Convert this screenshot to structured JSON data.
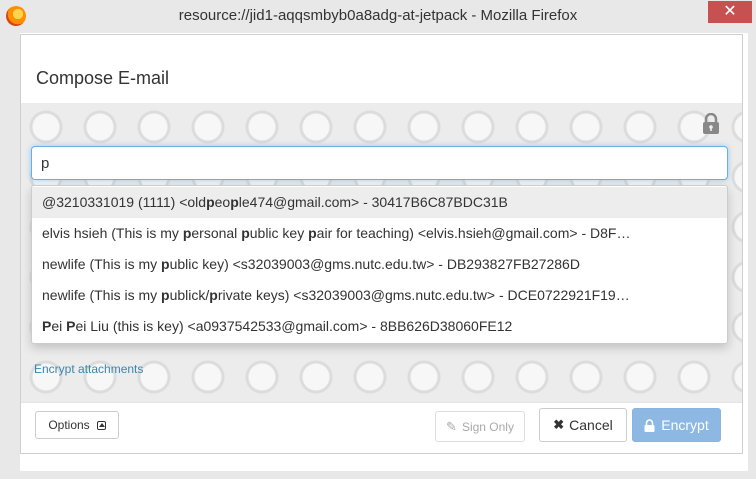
{
  "window": {
    "title": "resource://jid1-aqqsmbyb0a8adg-at-jetpack - Mozilla Firefox",
    "close_glyph": "✕"
  },
  "dialog": {
    "title": "Compose E-mail"
  },
  "recipient": {
    "value": "p"
  },
  "suggestions": [
    {
      "pre": "@3210331019 (1111) <old",
      "m1": "p",
      "mid": "eo",
      "m2": "p",
      "post": "le474@gmail.com> - 30417B6C87BDC31B",
      "active": true
    },
    {
      "pre": "elvis hsieh (This is my ",
      "m1": "p",
      "mid": "ersonal ",
      "m2": "p",
      "post": "ublic key ",
      "m3": "p",
      "post2": "air for teaching) <elvis.hsieh@gmail.com> - D8F…",
      "active": false
    },
    {
      "pre": "newlife (This is my ",
      "m1": "p",
      "post": "ublic key) <s32039003@gms.nutc.edu.tw> - DB293827FB27286D",
      "active": false
    },
    {
      "pre": "newlife (This is my ",
      "m1": "p",
      "mid": "ublick/",
      "m2": "p",
      "post": "rivate keys) <s32039003@gms.nutc.edu.tw> - DCE0722921F19…",
      "active": false
    },
    {
      "pre": "",
      "m1": "P",
      "mid": "ei ",
      "m2": "P",
      "post": "ei Liu (this is key) <a0937542533@gmail.com> - 8BB626D38060FE12",
      "active": false
    }
  ],
  "links": {
    "encrypt_attachments": "Encrypt attachments"
  },
  "footer": {
    "options_label": "Options",
    "sign_only_label": "Sign Only",
    "cancel_label": "Cancel",
    "encrypt_label": "Encrypt"
  },
  "colors": {
    "accent": "#66afe9",
    "encrypt_button": "#8db8e3",
    "link": "#3a87ad",
    "close_button": "#c75050"
  },
  "icons": {
    "window": "firefox-logo-icon",
    "lock": "lock-icon",
    "options": "caret-up-icon",
    "sign": "pencil-icon",
    "cancel": "close-icon",
    "encrypt": "lock-icon"
  }
}
